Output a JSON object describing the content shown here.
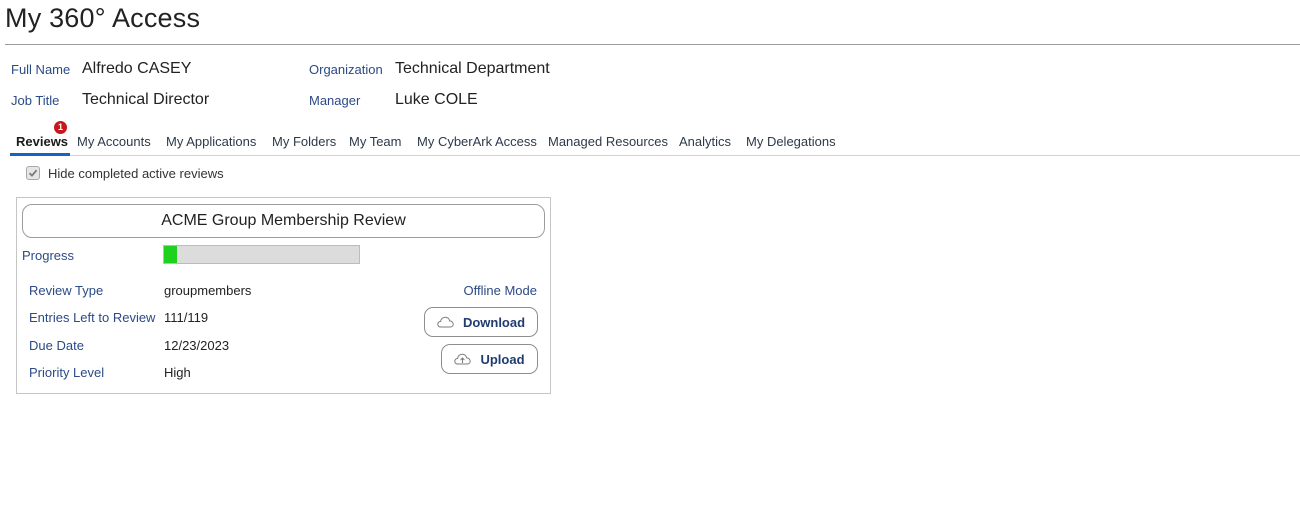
{
  "page": {
    "title": "My 360° Access"
  },
  "profile": {
    "full_name_label": "Full Name",
    "full_name": "Alfredo CASEY",
    "job_title_label": "Job Title",
    "job_title": "Technical Director",
    "organization_label": "Organization",
    "organization": "Technical Department",
    "manager_label": "Manager",
    "manager": "Luke COLE"
  },
  "tabs": [
    {
      "label": "Reviews",
      "active": true,
      "badge": "1"
    },
    {
      "label": "My Accounts"
    },
    {
      "label": "My Applications"
    },
    {
      "label": "My Folders"
    },
    {
      "label": "My Team"
    },
    {
      "label": "My CyberArk Access"
    },
    {
      "label": "Managed Resources"
    },
    {
      "label": "Analytics"
    },
    {
      "label": "My Delegations"
    }
  ],
  "filter": {
    "hide_completed_label": "Hide completed active reviews",
    "hide_completed_checked": true
  },
  "review_card": {
    "title": "ACME Group Membership Review",
    "progress_label": "Progress",
    "progress_fraction": 0.067,
    "review_type_label": "Review Type",
    "review_type": "groupmembers",
    "entries_left_label": "Entries Left to Review",
    "entries_left": "111/119",
    "due_date_label": "Due Date",
    "due_date": "12/23/2023",
    "priority_label": "Priority Level",
    "priority": "High",
    "offline_mode_label": "Offline Mode",
    "download_label": "Download",
    "upload_label": "Upload"
  },
  "icons": {
    "download": "cloud-download-icon",
    "upload": "cloud-upload-icon",
    "checkbox": "checkmark-icon"
  },
  "colors": {
    "accent": "#1565c0",
    "badge": "#c8161d",
    "progress": "#1fd11f",
    "label": "#2b4a86"
  }
}
